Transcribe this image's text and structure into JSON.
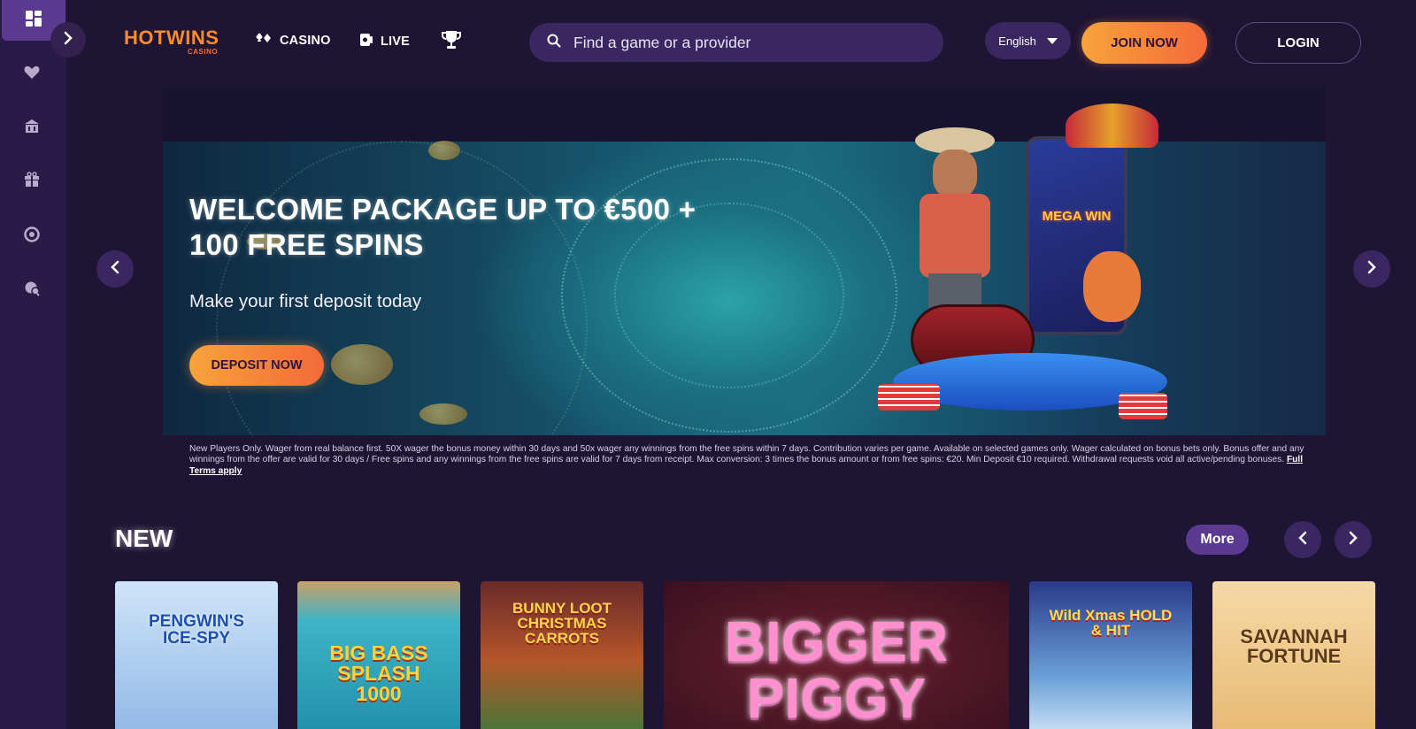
{
  "brand": {
    "logo_main": "HOTWINS",
    "logo_sub": "CASINO",
    "accent": "#f7923a"
  },
  "sidebar": {
    "items": [
      {
        "icon": "dashboard-icon"
      },
      {
        "icon": "heart-icon"
      },
      {
        "icon": "building-icon"
      },
      {
        "icon": "gift-icon"
      },
      {
        "icon": "target-icon"
      },
      {
        "icon": "support-icon"
      }
    ]
  },
  "nav": {
    "casino": "CASINO",
    "live": "LIVE"
  },
  "search": {
    "placeholder": "Find a game or a provider"
  },
  "language": {
    "selected": "English"
  },
  "auth": {
    "join": "JOIN NOW",
    "login": "LOGIN"
  },
  "banner": {
    "title_line1": "WELCOME PACKAGE UP TO €500 +",
    "title_line2": "100 FREE SPINS",
    "subtitle": "Make your first deposit today",
    "cta": "DEPOSIT NOW",
    "terms": "New Players Only. Wager from real balance first. 50X wager the bonus money within 30 days and 50x wager any winnings from the free spins within 7 days. Contribution varies per game. Available on selected games only. Wager calculated on bonus bets only. Bonus offer and any winnings from the offer are valid for 30 days / Free spins and any winnings from the free spins are valid for 7 days from receipt. Max conversion: 3 times the bonus amount or from free spins: €20. Min Deposit €10 required. Withdrawal requests void all active/pending bonuses.",
    "terms_link": "Full Terms apply",
    "reel_text": "MEGA WIN"
  },
  "new_section": {
    "title": "NEW",
    "more": "More",
    "games": [
      {
        "name": "PENGWIN'S ICE-SPY"
      },
      {
        "name": "BIG BASS SPLASH 1000"
      },
      {
        "name": "BUNNY LOOT CHRISTMAS CARROTS"
      },
      {
        "name": "BIGGER PIGGY"
      },
      {
        "name": "Wild Xmas HOLD & HIT"
      },
      {
        "name": "SAVANNAH FORTUNE"
      }
    ]
  }
}
